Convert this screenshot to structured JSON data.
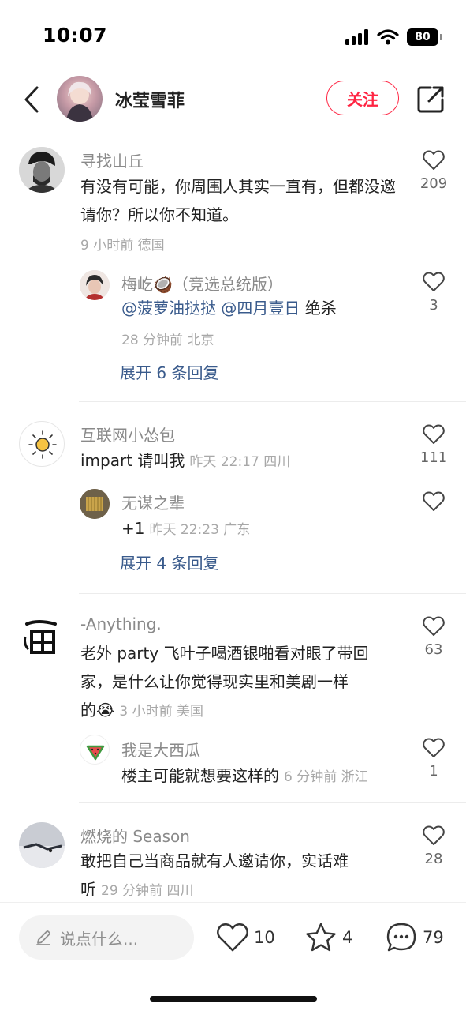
{
  "status_bar": {
    "time": "10:07",
    "battery": "80"
  },
  "header": {
    "title": "冰莹雪菲",
    "follow_label": "关注"
  },
  "comments": [
    {
      "username": "寻找山丘",
      "text": "有没有可能，你周围人其实一直有，但都没邀请你？所以你不知道。",
      "meta": "9 小时前 德国",
      "likes": "209",
      "reply": {
        "username": "梅屹🥥（竞选总统版）",
        "mention_1": "@菠萝油挞挞",
        "mention_2": "@四月壹日",
        "text": "绝杀",
        "meta": "28 分钟前 北京",
        "likes": "3"
      },
      "expand_label": "展开 6 条回复"
    },
    {
      "username": "互联网小怂包",
      "text": "impart 请叫我",
      "meta": "昨天 22:17 四川",
      "likes": "111",
      "reply": {
        "username": "无谋之辈",
        "text": "+1",
        "meta": "昨天 22:23 广东",
        "likes": ""
      },
      "expand_label": "展开 4 条回复"
    },
    {
      "username": "-Anything.",
      "text_line1": "老外 party 飞叶子喝酒银啪看对眼了带回",
      "text_line2": "家，是什么让你觉得现实里和美剧一样",
      "text_line3": "的😭",
      "meta": "3 小时前 美国",
      "likes": "63",
      "reply": {
        "username": "我是大西瓜",
        "text": "楼主可能就想要这样的",
        "meta": "6 分钟前 浙江",
        "likes": "1"
      }
    },
    {
      "username": "燃烧的 Season",
      "text_line1": "敢把自己当商品就有人邀请你，实话难",
      "text_line2": "听",
      "meta": "29 分钟前 四川",
      "likes": "28"
    }
  ],
  "bottom_bar": {
    "input_placeholder": "说点什么...",
    "like_count": "10",
    "collect_count": "4",
    "comment_count": "79"
  },
  "colors": {
    "accent": "#ff2442",
    "link": "#3a5b8c",
    "muted": "#8a8a8a"
  },
  "icons": [
    "back-icon",
    "share-icon",
    "heart-icon",
    "star-icon",
    "comment-bubble-icon",
    "pencil-icon",
    "signal-icon",
    "wifi-icon",
    "battery-icon"
  ]
}
